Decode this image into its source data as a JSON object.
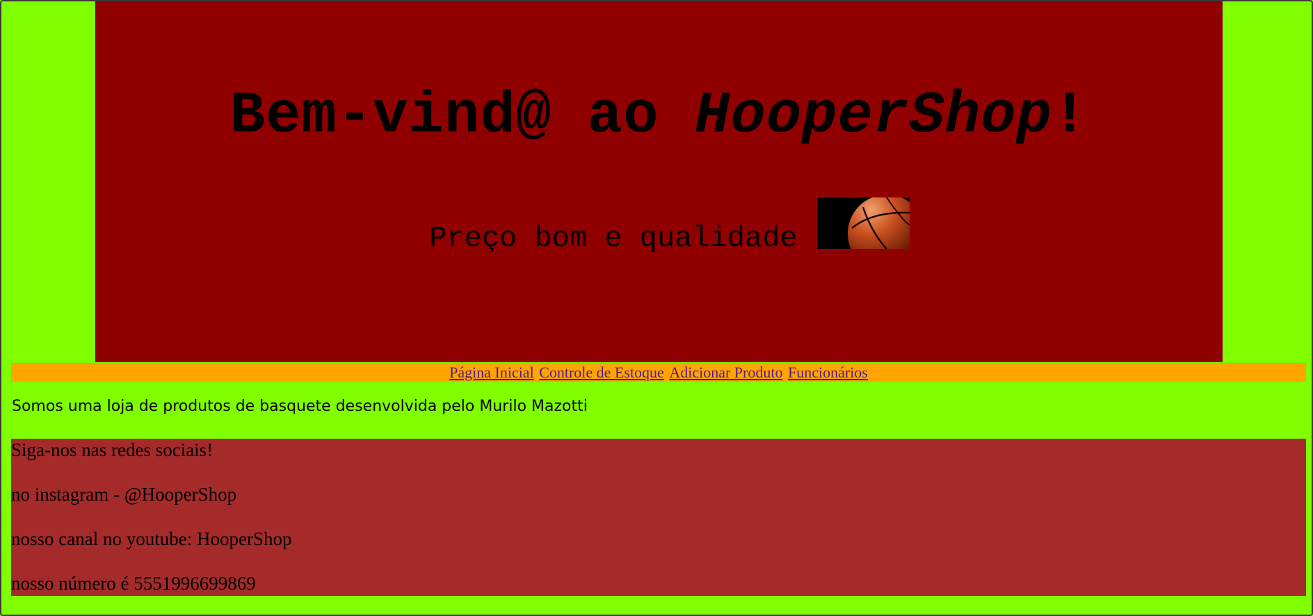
{
  "hero": {
    "title_prefix": "Bem-vind@ ao ",
    "title_brand": "HooperShop",
    "title_suffix": "!",
    "tagline": "Preço bom e qualidade",
    "image_icon": "basketball-image"
  },
  "nav": {
    "items": [
      {
        "label": "Página Inicial"
      },
      {
        "label": "Controle de Estoque"
      },
      {
        "label": "Adicionar Produto"
      },
      {
        "label": "Funcionários"
      }
    ]
  },
  "about": {
    "text": "Somos uma loja de produtos de basquete desenvolvida pelo Murilo Mazotti"
  },
  "social": {
    "heading": "Siga-nos nas redes sociais!",
    "lines": [
      "no instagram - @HooperShop",
      "nosso canal no youtube: HooperShop",
      "nosso número é 5551996699869"
    ]
  },
  "colors": {
    "page_bg": "#7fff00",
    "hero_bg": "#910000",
    "nav_bg": "#ffa500",
    "social_bg": "#a52a2a",
    "link": "#551a8b"
  }
}
